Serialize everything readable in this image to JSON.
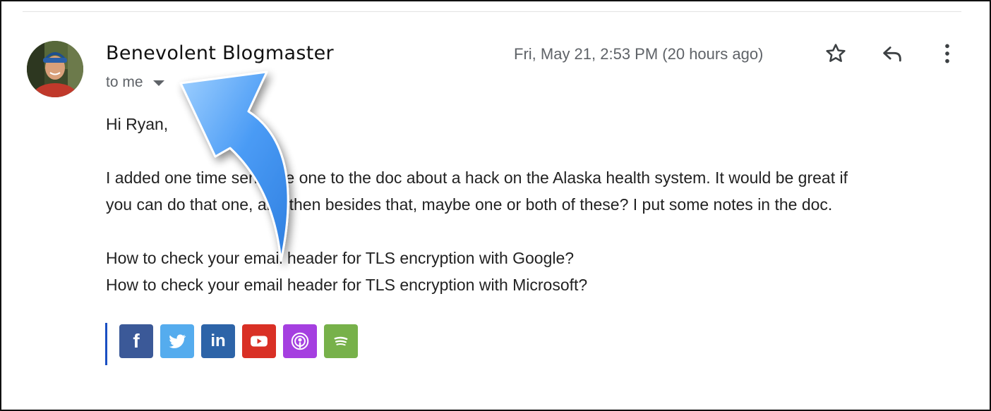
{
  "email": {
    "sender_name": "Benevolent Blogmaster",
    "recipient_label": "to me",
    "timestamp": "Fri, May 21, 2:53 PM (20 hours ago)",
    "greeting": "Hi Ryan,",
    "paragraph_line1": "I added one time sensitive one to the doc about a hack on the Alaska health system.  It would be great if",
    "paragraph_line2": "you can do that one, and then besides that, maybe one or both of these?  I put some notes in the doc.",
    "link_line1": "How to check your email header for TLS encryption with Google?",
    "link_line2": "How to check your email header for TLS encryption with Microsoft?"
  },
  "actions": {
    "star_icon": "star-icon",
    "reply_icon": "reply-icon",
    "more_icon": "more-vert-icon"
  },
  "social_links": [
    {
      "name": "facebook",
      "glyph": "f",
      "color": "#3b5998"
    },
    {
      "name": "twitter",
      "color": "#55acee"
    },
    {
      "name": "linkedin",
      "glyph": "in",
      "color": "#2d64a8"
    },
    {
      "name": "youtube",
      "color": "#d93025"
    },
    {
      "name": "podcasts",
      "color": "#a53fe0"
    },
    {
      "name": "spotify",
      "color": "#77b14a"
    }
  ],
  "colors": {
    "annotation_arrow": "#4a9bf5",
    "signature_bar": "#1a4fc2"
  }
}
